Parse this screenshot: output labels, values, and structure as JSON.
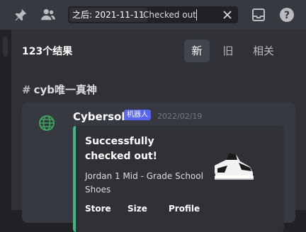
{
  "toolbar": {
    "pin_icon": "pin-icon",
    "members_icon": "members-icon",
    "inbox_icon": "inbox-icon",
    "help_icon": "help-icon"
  },
  "search": {
    "filter_chip": "之后: 2021-11-11",
    "query": "Checked out",
    "clear_icon": "close-icon"
  },
  "results": {
    "count": "123个结果",
    "sort_options": [
      "新",
      "旧",
      "相关"
    ],
    "active_sort": "新"
  },
  "channel": {
    "hash": "#",
    "name": "cyb唯一真神"
  },
  "message": {
    "author": "Cybersole",
    "bot_tag": "机器人",
    "timestamp": "2022/02/19",
    "embed": {
      "accent_color": "#43b581",
      "title": "Successfully checked out!",
      "description": "Jordan 1 Mid - Grade School Shoes",
      "field_labels": [
        "Store",
        "Size",
        "Profile"
      ]
    }
  },
  "colors": {
    "blurple": "#5865f2",
    "success_green": "#43b581",
    "avatar_green": "#3ba55d"
  }
}
